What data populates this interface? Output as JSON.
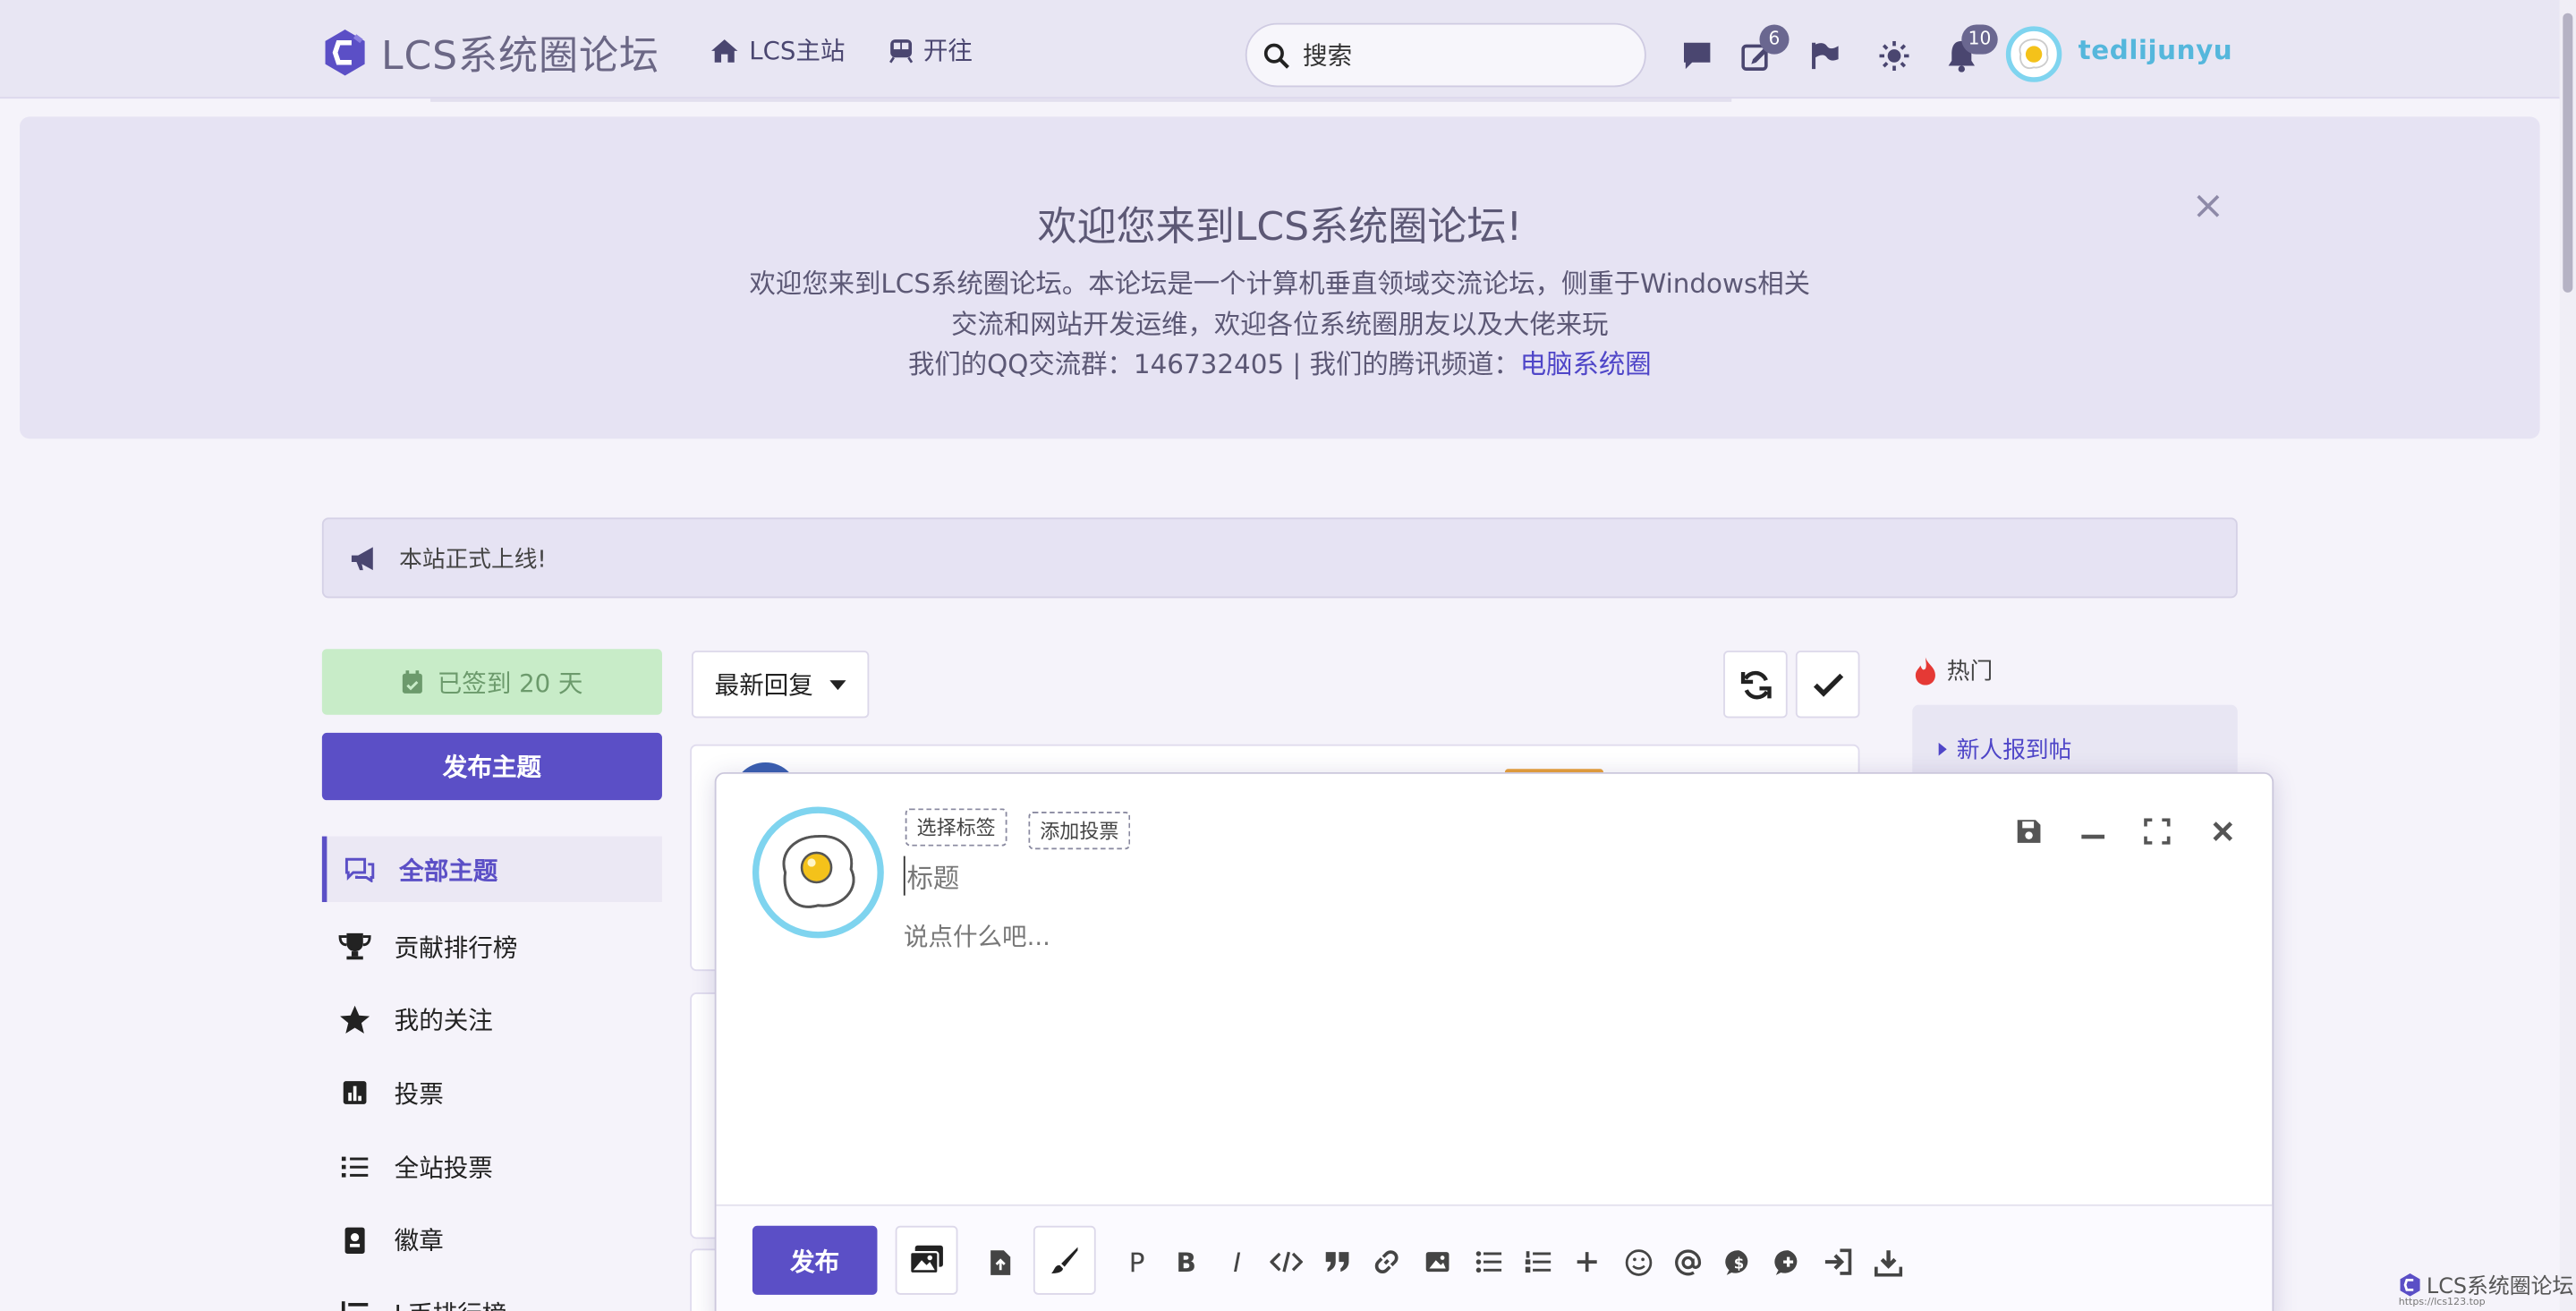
{
  "header": {
    "site_name": "LCS系统圈论坛",
    "nav": [
      {
        "label": "LCS主站",
        "icon": "home-icon"
      },
      {
        "label": "开往",
        "icon": "train-icon"
      }
    ],
    "search_placeholder": "搜索",
    "badges": {
      "drafts": "6",
      "notifications": "10"
    },
    "username": "tedlijunyu"
  },
  "hero": {
    "title": "欢迎您来到LCS系统圈论坛!",
    "line1": "欢迎您来到LCS系统圈论坛。本论坛是一个计算机垂直领域交流论坛，侧重于Windows相关",
    "line2": "交流和网站开发运维，欢迎各位系统圈朋友以及大佬来玩",
    "line3_prefix": "我们的QQ交流群：146732405 | 我们的腾讯频道：",
    "line3_link": "电脑系统圈",
    "close": "×"
  },
  "notice": {
    "text": "本站正式上线!"
  },
  "sidebar": {
    "signin_label": "已签到 20 天",
    "post_label": "发布主题",
    "items": [
      {
        "label": "全部主题",
        "icon": "comments-icon"
      },
      {
        "label": "贡献排行榜",
        "icon": "trophy-icon"
      },
      {
        "label": "我的关注",
        "icon": "star-icon"
      },
      {
        "label": "投票",
        "icon": "poll-icon"
      },
      {
        "label": "全站投票",
        "icon": "list-icon"
      },
      {
        "label": "徽章",
        "icon": "badge-icon"
      },
      {
        "label": "L币排行榜",
        "icon": "ranking-icon"
      }
    ]
  },
  "toolbar": {
    "sort_label": "最新回复"
  },
  "hot": {
    "title": "热门",
    "item": "新人报到帖"
  },
  "composer": {
    "tag_select": "选择标签",
    "add_poll": "添加投票",
    "title_placeholder": "标题",
    "body_placeholder": "说点什么吧...",
    "publish_label": "发布",
    "format_tools": [
      "P",
      "B",
      "I"
    ]
  },
  "watermark": {
    "label": "LCS系统圈论坛",
    "url": "https://lcs123.top"
  },
  "colors": {
    "accent": "#5b4fc6",
    "link": "#4f46c8",
    "avatar_ring": "#7fd4ef"
  }
}
